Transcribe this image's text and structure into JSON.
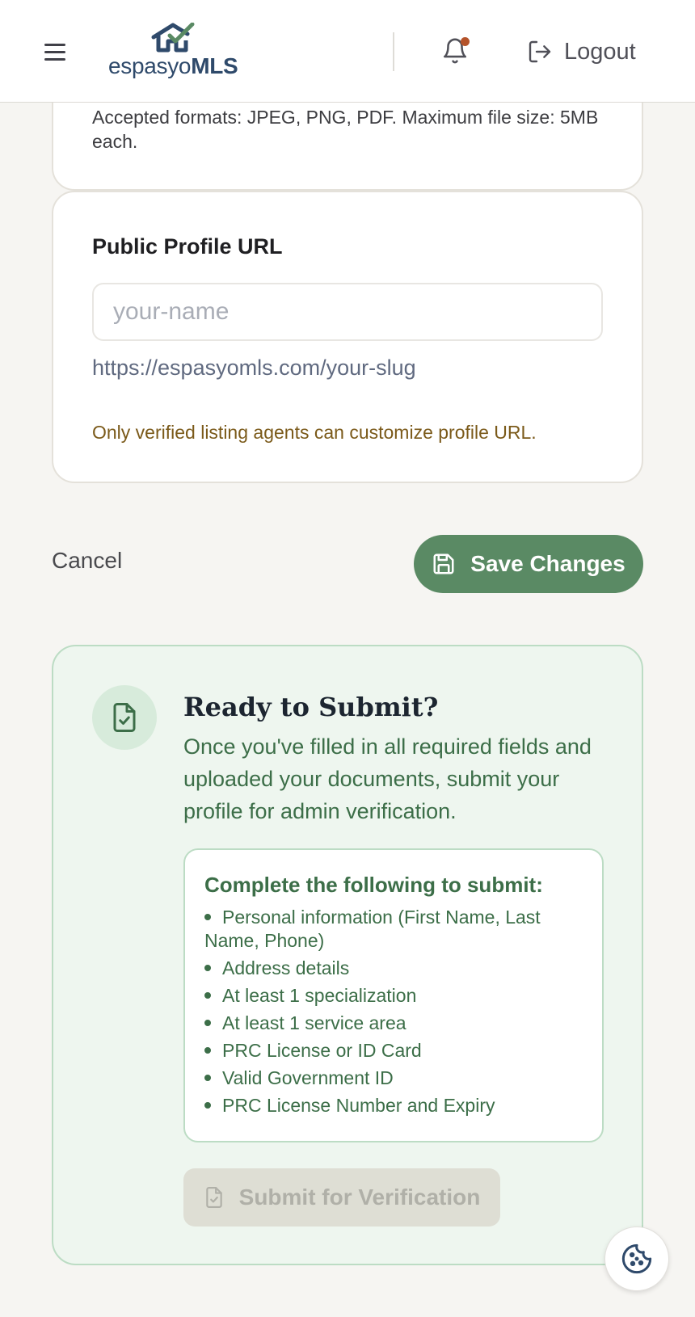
{
  "header": {
    "logo": {
      "part1": "espasyo",
      "part2": "MLS"
    },
    "logout_label": "Logout"
  },
  "documents": {
    "formats_note": "Accepted formats: JPEG, PNG, PDF. Maximum file size: 5MB each."
  },
  "profile_url": {
    "title": "Public Profile URL",
    "placeholder": "your-name",
    "preview": "https://espasyomls.com/your-slug",
    "note": "Only verified listing agents can customize profile URL."
  },
  "actions": {
    "cancel_label": "Cancel",
    "save_label": "Save Changes"
  },
  "submit": {
    "title": "Ready to Submit?",
    "description": "Once you've filled in all required fields and uploaded your documents, submit your profile for admin verification.",
    "requirements_title": "Complete the following to submit:",
    "requirements": [
      "Personal information (First Name, Last Name, Phone)",
      "Address details",
      "At least 1 specialization",
      "At least 1 service area",
      "PRC License or ID Card",
      "Valid Government ID",
      "PRC License Number and Expiry"
    ],
    "button_label": "Submit for Verification"
  },
  "icons": {
    "menu": "menu-icon",
    "bell": "bell-icon",
    "logout": "logout-icon",
    "save": "save-icon",
    "document_check": "document-check-icon",
    "cookie": "cookie-icon"
  },
  "colors": {
    "brand_navy": "#2f4a6b",
    "brand_green": "#5a8a64",
    "notification_dot": "#b4532a",
    "warning_text": "#7b5a1a",
    "success_bg": "#eef6ef",
    "success_text": "#3c6e48"
  }
}
